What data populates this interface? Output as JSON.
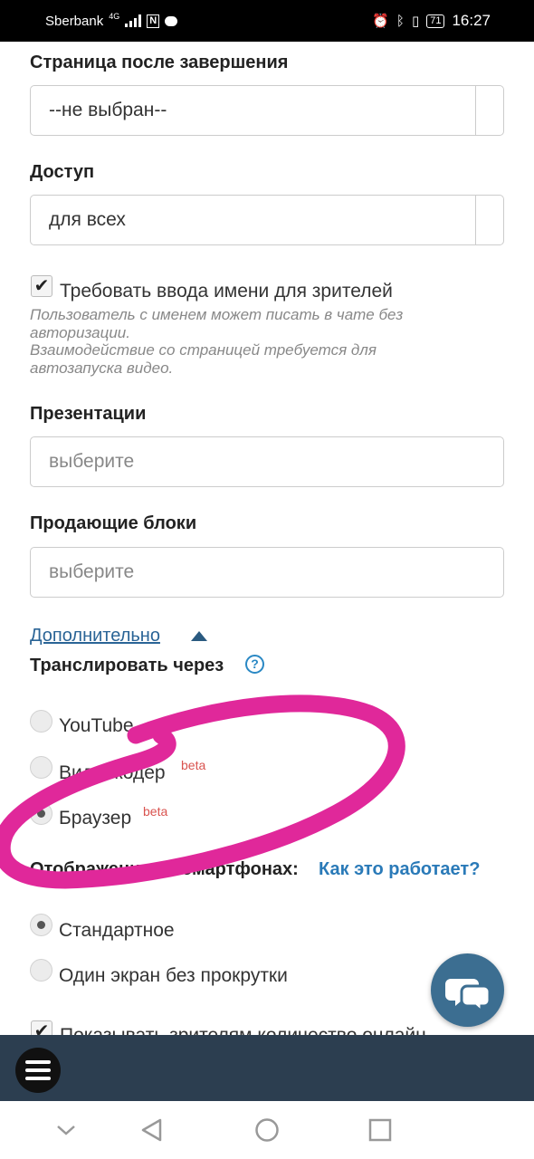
{
  "status_bar": {
    "carrier": "Sberbank",
    "network": "4G",
    "nfc": "N",
    "battery": "71",
    "time": "16:27"
  },
  "form": {
    "completion_page": {
      "label": "Страница после завершения",
      "value": "--не выбран--"
    },
    "access": {
      "label": "Доступ",
      "value": "для всех"
    },
    "require_name": {
      "label": "Требовать ввода имени для зрителей",
      "checked": true,
      "hint_line1": "Пользователь с именем может писать в чате без авторизации.",
      "hint_line2": "Взаимодействие со страницей требуется для автозапуска видео."
    },
    "presentations": {
      "label": "Презентации",
      "placeholder": "выберите"
    },
    "selling_blocks": {
      "label": "Продающие блоки",
      "placeholder": "выберите"
    },
    "advanced_link": "Дополнительно",
    "broadcast": {
      "label": "Транслировать через",
      "help": "?",
      "options": [
        {
          "label": "YouTube",
          "beta": "",
          "checked": false
        },
        {
          "label": "Видеокодер",
          "beta": "beta",
          "checked": false
        },
        {
          "label": "Браузер",
          "beta": "beta",
          "checked": true
        }
      ]
    },
    "smartphone_display": {
      "label": "Отображение на смартфонах:",
      "how_link": "Как это работает?",
      "options": [
        {
          "label": "Стандартное",
          "checked": true
        },
        {
          "label": "Один экран без прокрутки",
          "checked": false
        }
      ]
    },
    "show_online_count": {
      "label": "Показывать зрителям количество онлайн",
      "checked": true
    }
  },
  "colors": {
    "accent": "#2a6496",
    "beta": "#d9534f",
    "bottom_bar": "#2c3e50",
    "chat_button": "#3c6e91",
    "annotation": "#e0289a"
  },
  "icons": {
    "chat": "chat-bubbles-icon",
    "menu": "hamburger-menu-icon",
    "nav_back": "triangle-back-icon",
    "nav_home": "circle-home-icon",
    "nav_recent": "square-recent-icon",
    "nav_hide": "chevron-down-icon"
  }
}
